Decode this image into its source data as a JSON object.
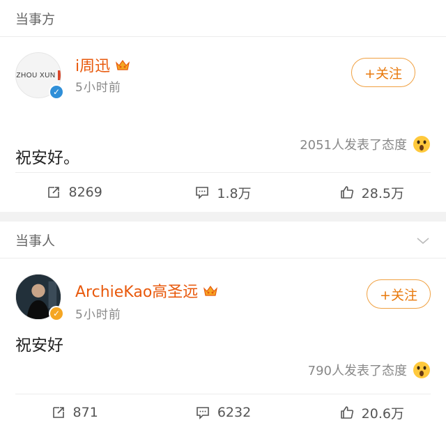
{
  "sections": [
    {
      "header": "当事方",
      "author": "i周迅",
      "avatar_text": "ZHOU XUN",
      "verified_color": "#2f8fd8",
      "time": "5小时前",
      "follow_label": "+关注",
      "content": "祝安好。",
      "reactions_text": "2051人发表了态度",
      "repost": "8269",
      "comments": "1.8万",
      "likes": "28.5万"
    },
    {
      "header": "当事人",
      "author": "ArchieKao高圣远",
      "verified_color": "#f5a623",
      "time": "5小时前",
      "follow_label": "+关注",
      "content": "祝安好",
      "reactions_text": "790人发表了态度",
      "repost": "871",
      "comments": "6232",
      "likes": "20.6万"
    }
  ],
  "colors": {
    "name": "#e8590c",
    "follow_border": "#f0a040",
    "meta": "#888888"
  },
  "icons": [
    "share-icon",
    "comment-icon",
    "like-icon",
    "crown-badge-icon",
    "verified-badge-icon",
    "wow-emoji-icon",
    "chevron-down-icon"
  ]
}
